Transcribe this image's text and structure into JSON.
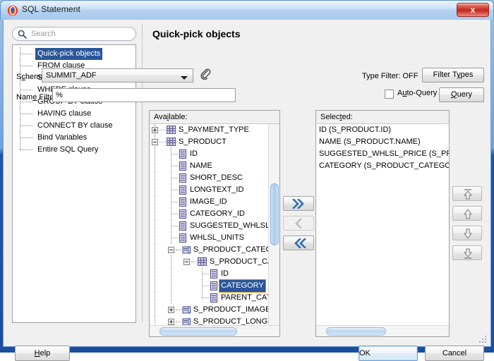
{
  "window": {
    "title": "SQL Statement",
    "icon": "oracle-logo-icon",
    "close_label": "x"
  },
  "search": {
    "placeholder": "Search",
    "value": "",
    "icon": "search-icon"
  },
  "nav": {
    "items": [
      {
        "label": "Quick-pick objects",
        "selected": true
      },
      {
        "label": "FROM clause",
        "selected": false
      },
      {
        "label": "SELECT clause",
        "selected": false
      },
      {
        "label": "WHERE clause",
        "selected": false
      },
      {
        "label": "GROUP BY clause",
        "selected": false
      },
      {
        "label": "HAVING clause",
        "selected": false
      },
      {
        "label": "CONNECT BY clause",
        "selected": false
      },
      {
        "label": "Bind Variables",
        "selected": false
      },
      {
        "label": "Entire SQL Query",
        "selected": false
      }
    ]
  },
  "content": {
    "title": "Quick-pick objects",
    "schema_label": "Schema:",
    "schema_value": "SUMMIT_ADF",
    "schema_icon": "paperclip-icon",
    "type_filter_status": "Type Filter: OFF",
    "filter_types_label": "Filter Types",
    "name_filter_label": "Name Filter:",
    "name_filter_value": "%",
    "auto_query_label": "Auto-Query",
    "auto_query_checked": false,
    "query_label": "Query"
  },
  "available": {
    "header": "Available:",
    "rows": [
      {
        "label": "S_PAYMENT_TYPE",
        "depth": 0,
        "icon": "table-icon",
        "expander": "plus",
        "highlight": false
      },
      {
        "label": "S_PRODUCT",
        "depth": 0,
        "icon": "table-icon",
        "expander": "minus",
        "highlight": false
      },
      {
        "label": "ID",
        "depth": 1,
        "icon": "column-icon",
        "expander": "none",
        "highlight": false
      },
      {
        "label": "NAME",
        "depth": 1,
        "icon": "column-icon",
        "expander": "none",
        "highlight": false
      },
      {
        "label": "SHORT_DESC",
        "depth": 1,
        "icon": "column-icon",
        "expander": "none",
        "highlight": false
      },
      {
        "label": "LONGTEXT_ID",
        "depth": 1,
        "icon": "column-icon",
        "expander": "none",
        "highlight": false
      },
      {
        "label": "IMAGE_ID",
        "depth": 1,
        "icon": "column-icon",
        "expander": "none",
        "highlight": false
      },
      {
        "label": "CATEGORY_ID",
        "depth": 1,
        "icon": "column-icon",
        "expander": "none",
        "highlight": false
      },
      {
        "label": "SUGGESTED_WHLSL_I",
        "depth": 1,
        "icon": "column-icon",
        "expander": "none",
        "highlight": false
      },
      {
        "label": "WHLSL_UNITS",
        "depth": 1,
        "icon": "column-icon",
        "expander": "none",
        "highlight": false
      },
      {
        "label": "S_PRODUCT_CATEGO",
        "depth": 1,
        "icon": "fk-icon",
        "expander": "minus",
        "highlight": false
      },
      {
        "label": "S_PRODUCT_CAT",
        "depth": 2,
        "icon": "table-icon",
        "expander": "minus",
        "highlight": false
      },
      {
        "label": "ID",
        "depth": 3,
        "icon": "column-icon",
        "expander": "none",
        "highlight": false
      },
      {
        "label": "CATEGORY",
        "depth": 3,
        "icon": "column-icon",
        "expander": "none",
        "highlight": true
      },
      {
        "label": "PARENT_CAT",
        "depth": 3,
        "icon": "column-icon",
        "expander": "none",
        "highlight": false
      },
      {
        "label": "S_PRODUCT_IMAGE_",
        "depth": 1,
        "icon": "fk-icon",
        "expander": "plus",
        "highlight": false
      },
      {
        "label": "S_PRODUCT_LONGTE",
        "depth": 1,
        "icon": "fk-icon",
        "expander": "plus",
        "highlight": false
      }
    ]
  },
  "selected": {
    "header": "Selected:",
    "rows": [
      "ID (S_PRODUCT.ID)",
      "NAME (S_PRODUCT.NAME)",
      "SUGGESTED_WHLSL_PRICE (S_PROD",
      "CATEGORY (S_PRODUCT_CATEGORI"
    ]
  },
  "transfer_buttons": [
    {
      "name": "add-all-button",
      "icon": "double-chevron-right-icon",
      "enabled": true
    },
    {
      "name": "remove-button",
      "icon": "single-chevron-left-icon",
      "enabled": false
    },
    {
      "name": "remove-all-button",
      "icon": "double-chevron-left-icon",
      "enabled": true
    }
  ],
  "order_buttons": [
    {
      "name": "move-to-top-button",
      "icon": "arrow-up-to-line-icon",
      "enabled": false
    },
    {
      "name": "move-up-button",
      "icon": "arrow-up-icon",
      "enabled": false
    },
    {
      "name": "move-down-button",
      "icon": "arrow-down-icon",
      "enabled": false
    },
    {
      "name": "move-to-bottom-button",
      "icon": "arrow-down-to-line-icon",
      "enabled": false
    }
  ],
  "footer": {
    "help_label": "Help",
    "ok_label": "OK",
    "cancel_label": "Cancel"
  },
  "colors": {
    "titlebar_border": "#1b4e9e",
    "selection_blue": "#2a5699",
    "focus_orange": "#e08b21",
    "close_red": "#c0281c",
    "panel_gray": "#f0f0f0"
  }
}
